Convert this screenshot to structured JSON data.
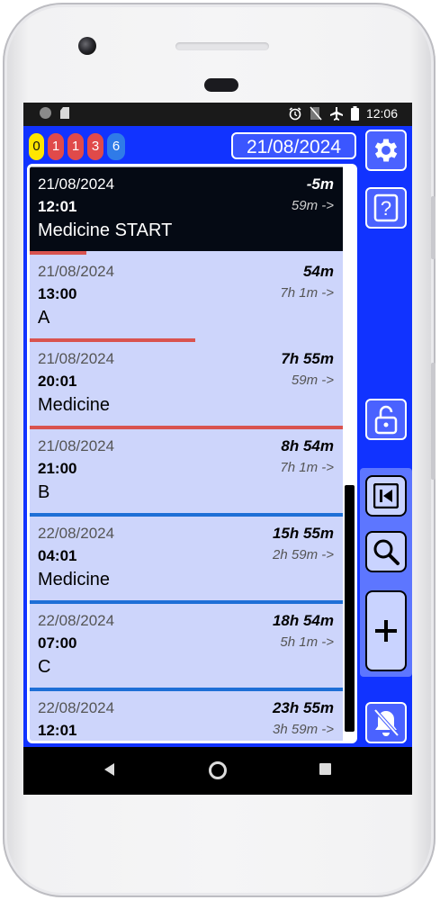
{
  "status_bar": {
    "time": "12:06",
    "icons_left": [
      "circle-icon",
      "sd-card-icon"
    ],
    "icons_right": [
      "alarm-icon",
      "no-sim-icon",
      "airplane-icon",
      "battery-icon"
    ]
  },
  "badges": [
    {
      "label": "0",
      "color": "#ffe600"
    },
    {
      "label": "1",
      "color": "#e04a4a"
    },
    {
      "label": "1",
      "color": "#e04a4a"
    },
    {
      "label": "3",
      "color": "#e04a4a"
    },
    {
      "label": "6",
      "color": "#2f7be8"
    }
  ],
  "header": {
    "date": "21/08/2024"
  },
  "entries": [
    {
      "date": "21/08/2024",
      "time": "12:01",
      "name": "Medicine START",
      "delta": "-5m",
      "next": "59m ->",
      "bar_color": "#9e9e9e",
      "bar_fraction": 1.0
    },
    {
      "date": "21/08/2024",
      "time": "13:00",
      "name": "A",
      "delta": "54m",
      "next": "7h 1m ->",
      "bar_color": "#d9534f",
      "bar_fraction": 0.18
    },
    {
      "date": "21/08/2024",
      "time": "20:01",
      "name": "Medicine",
      "delta": "7h 55m",
      "next": "59m ->",
      "bar_color": "#d9534f",
      "bar_fraction": 0.53
    },
    {
      "date": "21/08/2024",
      "time": "21:00",
      "name": "B",
      "delta": "8h 54m",
      "next": "7h 1m ->",
      "bar_color": "#d9534f",
      "bar_fraction": 1.0
    },
    {
      "date": "22/08/2024",
      "time": "04:01",
      "name": "Medicine",
      "delta": "15h 55m",
      "next": "2h 59m ->",
      "bar_color": "#1e6fd6",
      "bar_fraction": 1.0
    },
    {
      "date": "22/08/2024",
      "time": "07:00",
      "name": "C",
      "delta": "18h 54m",
      "next": "5h 1m ->",
      "bar_color": "#1e6fd6",
      "bar_fraction": 1.0
    },
    {
      "date": "22/08/2024",
      "time": "12:01",
      "name": "",
      "delta": "23h 55m",
      "next": "3h 59m ->",
      "bar_color": "#1e6fd6",
      "bar_fraction": 1.0
    }
  ],
  "colors": {
    "app_background": "#1133ff",
    "active_row": "#050a14",
    "row_background": "#cdd5fb"
  }
}
